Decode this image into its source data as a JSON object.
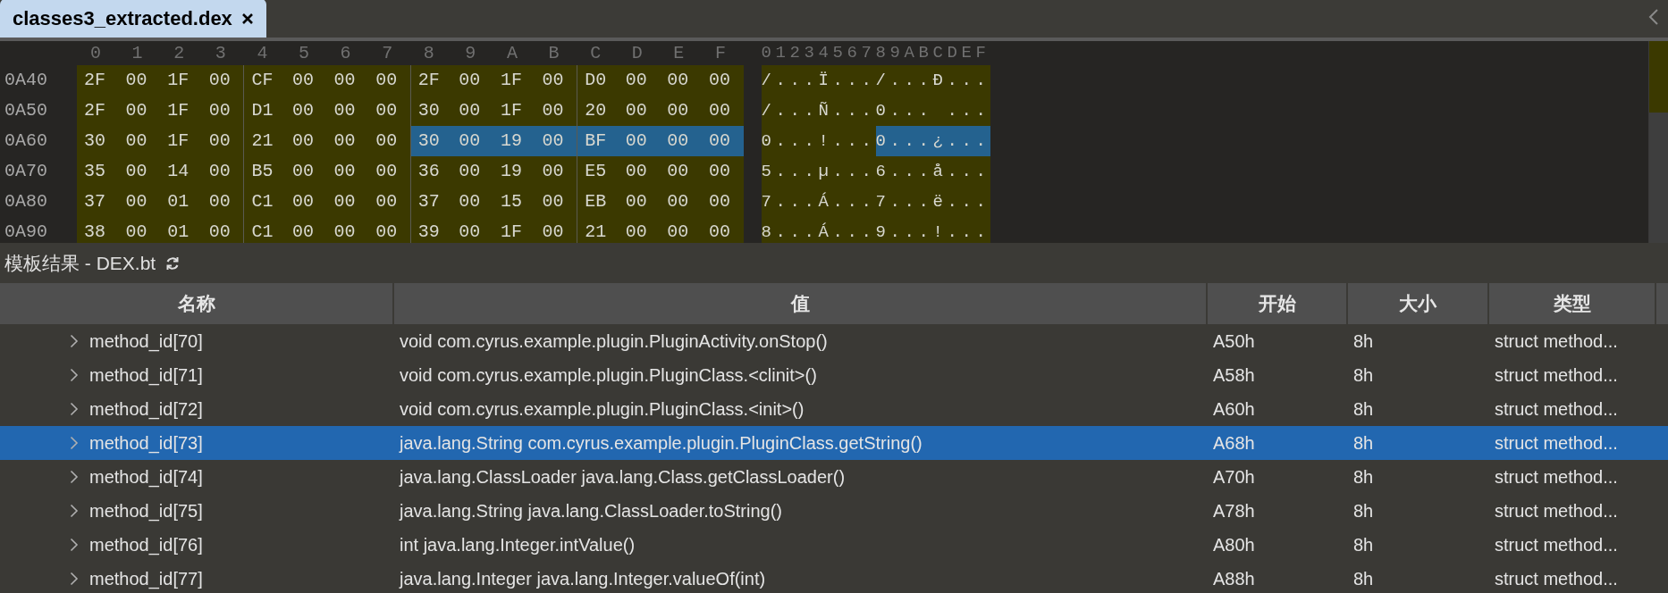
{
  "tab": {
    "title": "classes3_extracted.dex",
    "selected": true
  },
  "hex": {
    "column_header": [
      "0",
      "1",
      "2",
      "3",
      "4",
      "5",
      "6",
      "7",
      "8",
      "9",
      "A",
      "B",
      "C",
      "D",
      "E",
      "F"
    ],
    "ascii_header": "0123456789ABCDEF",
    "rows": [
      {
        "offset": "0A40",
        "bytes": [
          "2F",
          "00",
          "1F",
          "00",
          "CF",
          "00",
          "00",
          "00",
          "2F",
          "00",
          "1F",
          "00",
          "D0",
          "00",
          "00",
          "00"
        ],
        "ascii_first": "/...Ï...",
        "ascii_second": "/...Ð...",
        "first_half_selected": false,
        "second_half_selected": false
      },
      {
        "offset": "0A50",
        "bytes": [
          "2F",
          "00",
          "1F",
          "00",
          "D1",
          "00",
          "00",
          "00",
          "30",
          "00",
          "1F",
          "00",
          "20",
          "00",
          "00",
          "00"
        ],
        "ascii_first": "/...Ñ...",
        "ascii_second": "0... ...",
        "first_half_selected": false,
        "second_half_selected": false
      },
      {
        "offset": "0A60",
        "bytes": [
          "30",
          "00",
          "1F",
          "00",
          "21",
          "00",
          "00",
          "00",
          "30",
          "00",
          "19",
          "00",
          "BF",
          "00",
          "00",
          "00"
        ],
        "ascii_first": "0...!...",
        "ascii_second": "0...¿...",
        "first_half_selected": false,
        "second_half_selected": true
      },
      {
        "offset": "0A70",
        "bytes": [
          "35",
          "00",
          "14",
          "00",
          "B5",
          "00",
          "00",
          "00",
          "36",
          "00",
          "19",
          "00",
          "E5",
          "00",
          "00",
          "00"
        ],
        "ascii_first": "5...µ...",
        "ascii_second": "6...å...",
        "first_half_selected": false,
        "second_half_selected": false
      },
      {
        "offset": "0A80",
        "bytes": [
          "37",
          "00",
          "01",
          "00",
          "C1",
          "00",
          "00",
          "00",
          "37",
          "00",
          "15",
          "00",
          "EB",
          "00",
          "00",
          "00"
        ],
        "ascii_first": "7...Á...",
        "ascii_second": "7...ë...",
        "first_half_selected": false,
        "second_half_selected": false
      },
      {
        "offset": "0A90",
        "bytes": [
          "38",
          "00",
          "01",
          "00",
          "C1",
          "00",
          "00",
          "00",
          "39",
          "00",
          "1F",
          "00",
          "21",
          "00",
          "00",
          "00"
        ],
        "ascii_first": "8...Á...",
        "ascii_second": "9...!...",
        "first_half_selected": false,
        "second_half_selected": false
      }
    ]
  },
  "template_results": {
    "title": "模板结果 - DEX.bt",
    "columns": [
      "名称",
      "值",
      "开始",
      "大小",
      "类型"
    ],
    "rows": [
      {
        "name": "method_id[70]",
        "value": "void com.cyrus.example.plugin.PluginActivity.onStop()",
        "start": "A50h",
        "size": "8h",
        "type": "struct method...",
        "selected": false
      },
      {
        "name": "method_id[71]",
        "value": "void com.cyrus.example.plugin.PluginClass.<clinit>()",
        "start": "A58h",
        "size": "8h",
        "type": "struct method...",
        "selected": false
      },
      {
        "name": "method_id[72]",
        "value": "void com.cyrus.example.plugin.PluginClass.<init>()",
        "start": "A60h",
        "size": "8h",
        "type": "struct method...",
        "selected": false
      },
      {
        "name": "method_id[73]",
        "value": "java.lang.String com.cyrus.example.plugin.PluginClass.getString()",
        "start": "A68h",
        "size": "8h",
        "type": "struct method...",
        "selected": true
      },
      {
        "name": "method_id[74]",
        "value": "java.lang.ClassLoader java.lang.Class.getClassLoader()",
        "start": "A70h",
        "size": "8h",
        "type": "struct method...",
        "selected": false
      },
      {
        "name": "method_id[75]",
        "value": "java.lang.String java.lang.ClassLoader.toString()",
        "start": "A78h",
        "size": "8h",
        "type": "struct method...",
        "selected": false
      },
      {
        "name": "method_id[76]",
        "value": "int java.lang.Integer.intValue()",
        "start": "A80h",
        "size": "8h",
        "type": "struct method...",
        "selected": false
      },
      {
        "name": "method_id[77]",
        "value": "java.lang.Integer java.lang.Integer.valueOf(int)",
        "start": "A88h",
        "size": "8h",
        "type": "struct method...",
        "selected": false
      }
    ]
  }
}
